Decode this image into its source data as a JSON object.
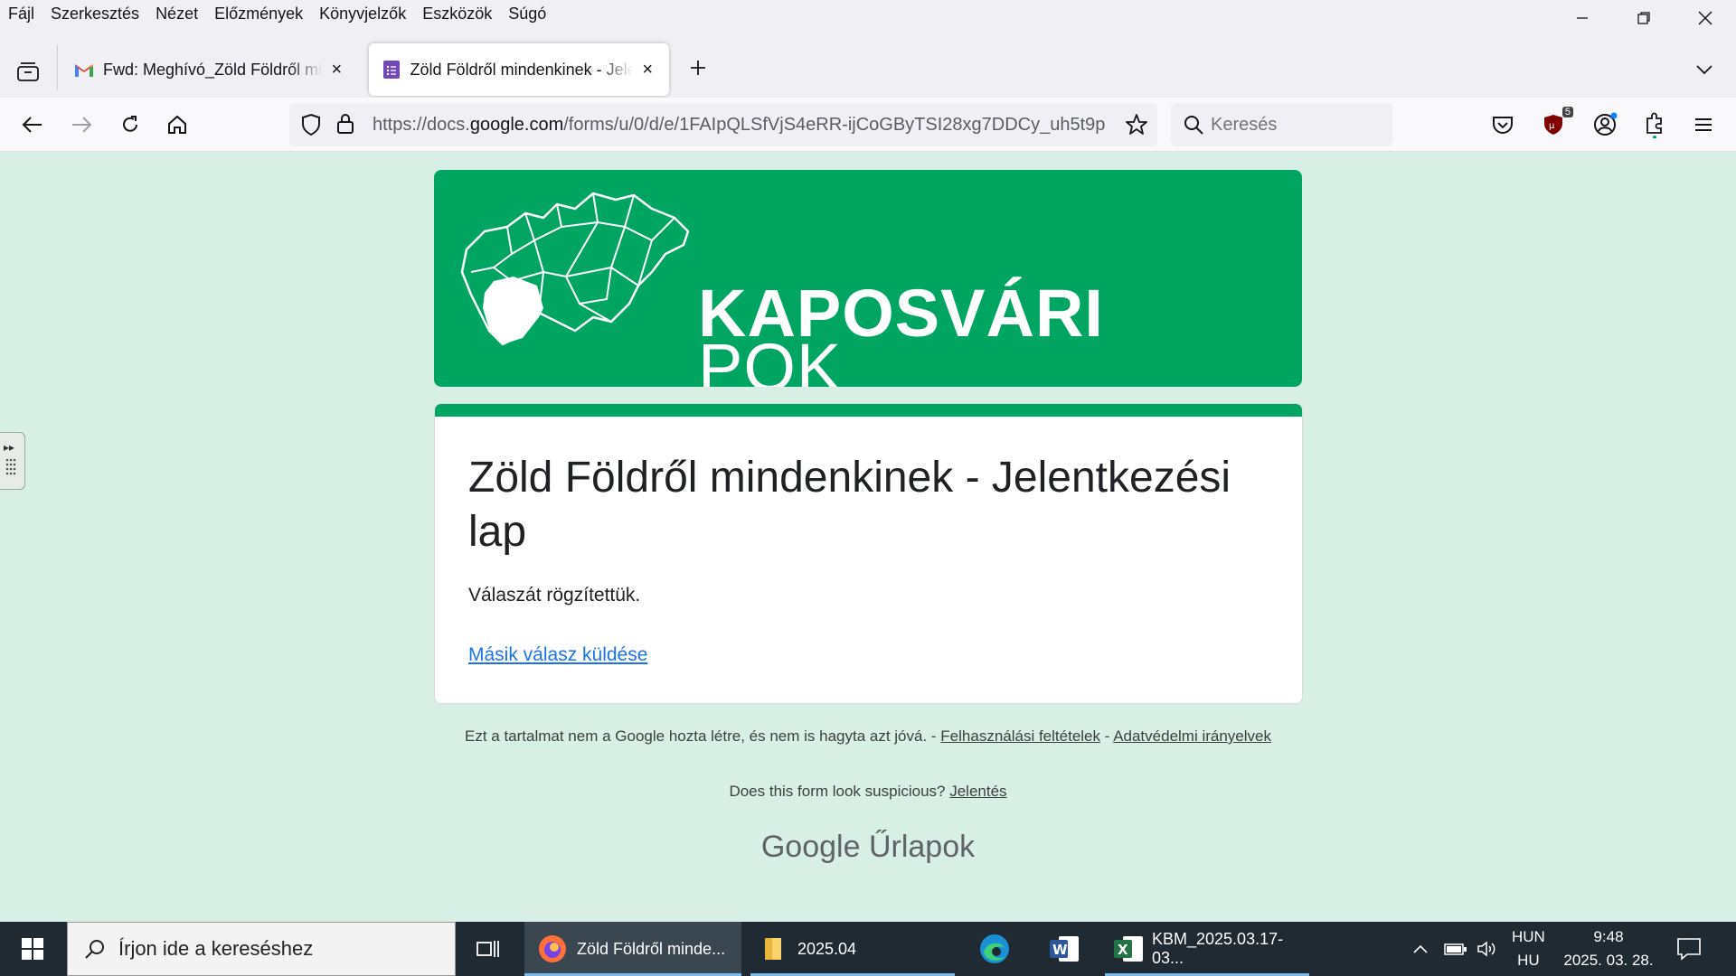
{
  "menu": [
    "Fájl",
    "Szerkesztés",
    "Nézet",
    "Előzmények",
    "Könyvjelzők",
    "Eszközök",
    "Súgó"
  ],
  "tabs": [
    {
      "label": "Fwd: Meghívó_Zöld Földről mindenkinek",
      "icon": "gmail-icon"
    },
    {
      "label": "Zöld Földről mindenkinek - Jelentkezési lap",
      "icon": "google-forms-icon"
    }
  ],
  "navbar": {
    "url_prefix": "https://docs.",
    "url_domain": "google.com",
    "url_rest": "/forms/u/0/d/e/1FAIpQLSfVjS4eRR-ijCoGByTSI28xg7DDCy_uh5t9p",
    "search_placeholder": "Keresés",
    "extension_badge": "5"
  },
  "banner": {
    "title": "KAPOSVÁRI",
    "subtitle": "POK"
  },
  "form": {
    "title": "Zöld Földről mindenkinek - Jelentkezési lap",
    "message": "Válaszát rögzítettük.",
    "resubmit_link": "Másik válasz küldése"
  },
  "footer": {
    "disclaimer": "Ezt a tartalmat nem a Google hozta létre, és nem is hagyta azt jóvá. - ",
    "terms_link": "Felhasználási feltételek",
    "separator": " - ",
    "privacy_link": "Adatvédelmi irányelvek",
    "suspicious_q": "Does this form look suspicious?",
    "report_link": "Jelentés",
    "brand_google": "Google",
    "brand_forms": "Űrlapok"
  },
  "taskbar": {
    "search_placeholder": "Írjon ide a kereséshez",
    "firefox_label": "Zöld Földről minde...",
    "folder_label": "2025.04",
    "excel_label": "KBM_2025.03.17-03...",
    "lang_top": "HUN",
    "lang_bottom": "HU",
    "time": "9:48",
    "date": "2025. 03. 28."
  },
  "colors": {
    "brand_green": "#00a562",
    "page_bg": "#d7efe4",
    "link_blue": "#1a73e8"
  }
}
